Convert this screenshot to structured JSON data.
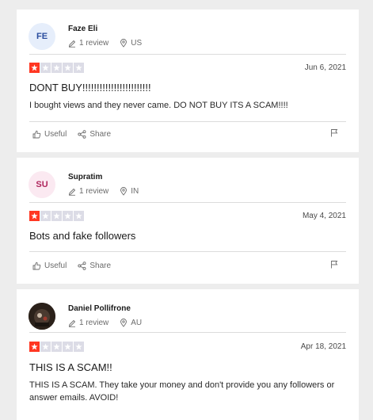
{
  "colors": {
    "star_on": "#ff3722",
    "star_off": "#dcdce6"
  },
  "actions": {
    "useful": "Useful",
    "share": "Share"
  },
  "reviews": [
    {
      "avatar_initials": "FE",
      "avatar_bg": "#e6eefb",
      "avatar_fg": "#2a4d9e",
      "name": "Faze Eli",
      "review_count": "1 review",
      "country": "US",
      "rating": 1,
      "date": "Jun 6, 2021",
      "title": "DONT BUY!!!!!!!!!!!!!!!!!!!!!!!!",
      "body": "I bought views and they never came. DO NOT BUY ITS A SCAM!!!!"
    },
    {
      "avatar_initials": "SU",
      "avatar_bg": "#fbe9f1",
      "avatar_fg": "#b0275e",
      "name": "Supratim",
      "review_count": "1 review",
      "country": "IN",
      "rating": 1,
      "date": "May 4, 2021",
      "title": "Bots and fake followers",
      "body": ""
    },
    {
      "avatar_initials": "",
      "avatar_bg": "#2b211a",
      "avatar_fg": "#ffffff",
      "name": "Daniel Pollifrone",
      "review_count": "1 review",
      "country": "AU",
      "rating": 1,
      "date": "Apr 18, 2021",
      "title": "THIS IS A SCAM!!",
      "body": "THIS IS A SCAM. They take your money and don't provide you any followers or answer emails. AVOID!"
    }
  ]
}
